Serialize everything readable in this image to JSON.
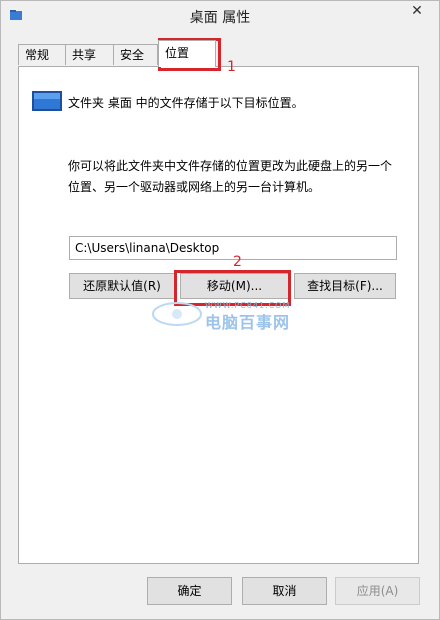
{
  "window": {
    "title": "桌面 属性",
    "close_label": "✕",
    "folder_icon": "desktop-folder-icon"
  },
  "tabs": [
    {
      "label": "常规",
      "active": false
    },
    {
      "label": "共享",
      "active": false
    },
    {
      "label": "安全",
      "active": false
    },
    {
      "label": "位置",
      "active": true
    }
  ],
  "content": {
    "description": "文件夹 桌面 中的文件存储于以下目标位置。",
    "info_line1": "你可以将此文件夹中文件存储的位置更改为此硬盘上的另一个",
    "info_line2": "位置、另一个驱动器或网络上的另一台计算机。",
    "path_value": "C:\\Users\\linana\\Desktop",
    "restore_label": "还原默认值(R)",
    "move_label": "移动(M)...",
    "find_label": "查找目标(F)..."
  },
  "annotations": {
    "marker1": "1",
    "marker2": "2",
    "color": "#d6262b"
  },
  "watermark": {
    "url": "WWW.PC841.COM",
    "name": "电脑百事网"
  },
  "footer": {
    "ok_label": "确定",
    "cancel_label": "取消",
    "apply_label": "应用(A)"
  }
}
